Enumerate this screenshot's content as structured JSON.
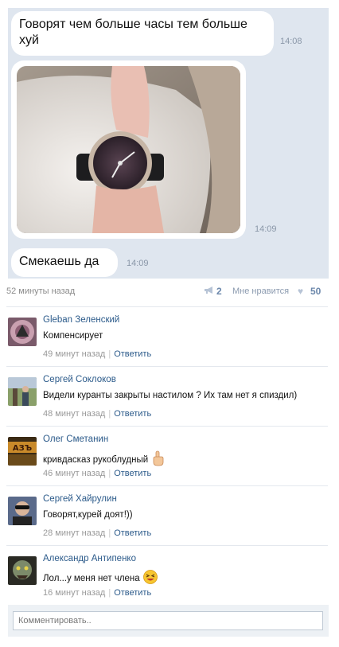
{
  "messages": [
    {
      "text": "Говорят чем больше часы тем больше хуй",
      "time": "14:08"
    },
    {
      "type": "photo",
      "time": "14:09"
    },
    {
      "text": "Смекаешь да",
      "time": "14:09"
    }
  ],
  "post_meta": {
    "ago": "52 минуты назад",
    "repost_count": "2",
    "like_label": "Мне нравится",
    "like_count": "50"
  },
  "comments": [
    {
      "author": "Gleban Зеленский",
      "text": "Компенсирует",
      "ago": "49 минут назад",
      "reply": "Ответить",
      "emoji": ""
    },
    {
      "author": "Сергей Соклоков",
      "text": "Видели куранты закрыты настилом ? Их там нет я спиздил)",
      "ago": "48 минут назад",
      "reply": "Ответить",
      "emoji": ""
    },
    {
      "author": "Олег Сметанин",
      "text": "кривдасказ рукоблудный",
      "ago": "46 минут назад",
      "reply": "Ответить",
      "emoji": "pointing-up-hand"
    },
    {
      "author": "Сергей Хайрулин",
      "text": "Говорят,курей доят!))",
      "ago": "28 минут назад",
      "reply": "Ответить",
      "emoji": ""
    },
    {
      "author": "Александр Антипенко",
      "text": "Лол...у меня нет члена",
      "ago": "16 минут назад",
      "reply": "Ответить",
      "emoji": "laughing-face"
    }
  ],
  "comment_input": {
    "placeholder": "Комментировать.."
  },
  "colors": {
    "link": "#2b5a8a",
    "chat_bg": "#dfe6ef",
    "meta_count": "#6b87ab"
  }
}
